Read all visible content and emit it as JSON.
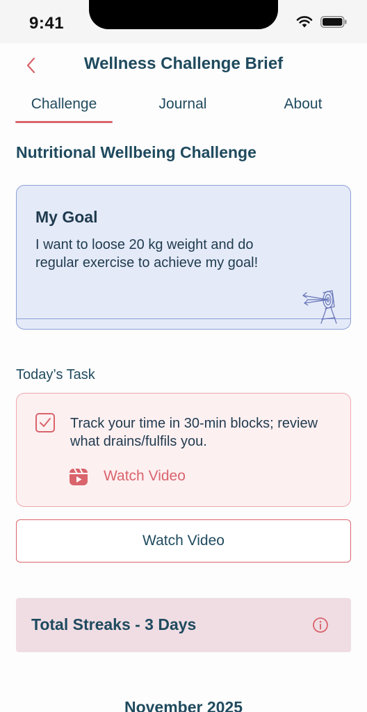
{
  "status_bar": {
    "time": "9:41",
    "wifi_icon": "wifi-icon",
    "battery_icon": "battery-icon"
  },
  "header": {
    "title": "Wellness Challenge Brief",
    "back_icon": "chevron-left-icon"
  },
  "tabs": [
    {
      "label": "Challenge",
      "active": true
    },
    {
      "label": "Journal",
      "active": false
    },
    {
      "label": "About",
      "active": false
    }
  ],
  "challenge": {
    "title": "Nutritional Wellbeing Challenge"
  },
  "goal": {
    "heading": "My Goal",
    "text": "I want to loose 20 kg weight and do regular exercise to achieve my goal!",
    "illustration": "archery-target-icon"
  },
  "today": {
    "label": "Today’s Task",
    "task_text": "Track your time in 30-min blocks; review what drains/fulfils you.",
    "checked": true,
    "video_link_label": "Watch Video",
    "video_icon": "reel-icon"
  },
  "watch_button": {
    "label": "Watch Video"
  },
  "streak": {
    "label": "Total Streaks - 3 Days",
    "icon": "info-icon"
  },
  "calendar": {
    "month_label": "November 2025"
  },
  "colors": {
    "primary_text": "#1f4a5e",
    "accent": "#d9646c",
    "goal_bg": "#e4eaf8",
    "goal_border": "#8d9fd6",
    "task_bg": "#fdf0f1",
    "streak_bg": "#f0dde4"
  }
}
